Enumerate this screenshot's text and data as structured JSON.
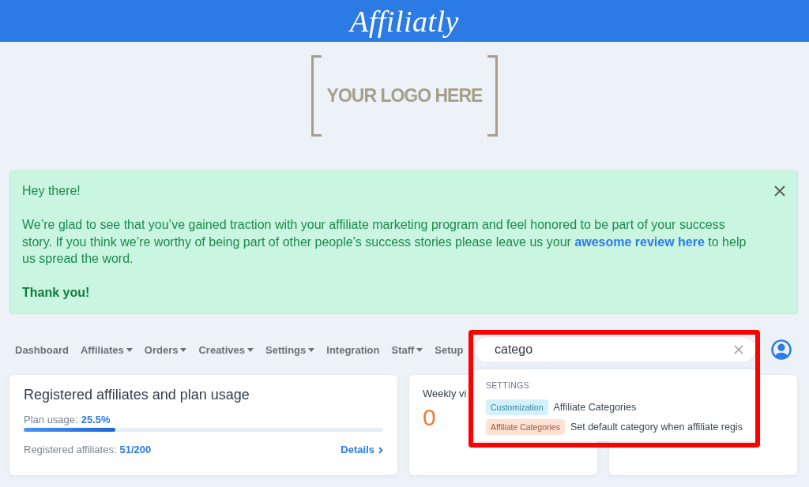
{
  "header": {
    "title": "Affiliatly"
  },
  "logo": {
    "text": "YOUR LOGO HERE"
  },
  "alert": {
    "greeting": "Hey there!",
    "message_start": "We’re glad to see that you’ve gained traction with your affiliate marketing program and feel honored to be part of your success story. If you think we’re worthy of being part of other people’s success stories please leave us your ",
    "link": "awesome review here",
    "message_end": " to help us spread the word.",
    "closing": "Thank you!"
  },
  "nav": {
    "items": [
      {
        "label": "Dashboard",
        "dropdown": false
      },
      {
        "label": "Affiliates",
        "dropdown": true
      },
      {
        "label": "Orders",
        "dropdown": true
      },
      {
        "label": "Creatives",
        "dropdown": true
      },
      {
        "label": "Settings",
        "dropdown": true
      },
      {
        "label": "Integration",
        "dropdown": false
      },
      {
        "label": "Staff",
        "dropdown": true
      },
      {
        "label": "Setup",
        "dropdown": false
      }
    ]
  },
  "search": {
    "value": "catego",
    "results": {
      "section": "SETTINGS",
      "items": [
        {
          "tag": "Customization",
          "color": "#d4f1fb",
          "title": "Affiliate Categories"
        },
        {
          "tag": "Affiliate Categories",
          "color": "#fde3d6",
          "title": "Set default category when affiliate regis"
        }
      ]
    }
  },
  "cards": [
    {
      "kind": "usage",
      "title": "Registered affiliates and plan usage",
      "usage_label": "Plan usage:",
      "usage_value": "25.5%",
      "level": 0.255,
      "count_label": "Registered affiliates:",
      "count_value": "51/200",
      "link": "Details"
    },
    {
      "kind": "stat",
      "title": "Weekly vi",
      "value": "0"
    },
    {
      "kind": "blank"
    }
  ]
}
